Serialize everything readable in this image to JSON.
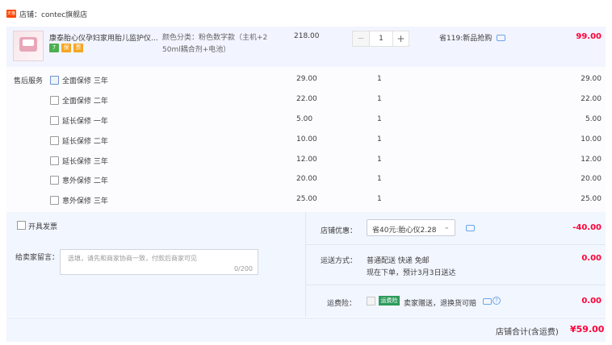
{
  "shop": {
    "badge": "天猫",
    "label": "店铺：contec旗舰店"
  },
  "item": {
    "title": "康泰胎心仪孕妇家用胎儿监护仪...",
    "tags": [
      {
        "text": "7",
        "color": "#4caf50"
      },
      {
        "text": "保",
        "color": "#f5a623"
      },
      {
        "text": "票",
        "color": "#f5a623"
      }
    ],
    "spec_line1": "颜色分类：粉色数字款（主机+2",
    "spec_line2": "50ml耦合剂+电池）",
    "unit_price": "218.00",
    "qty_minus": "−",
    "qty_value": "1",
    "qty_plus": "+",
    "save_text": "省119:新品抢购",
    "total": "99.00"
  },
  "services": {
    "label": "售后服务",
    "rows": [
      {
        "name": "全面保修 三年",
        "price": "29.00",
        "qty": "1",
        "total": "29.00"
      },
      {
        "name": "全面保修 二年",
        "price": "22.00",
        "qty": "1",
        "total": "22.00"
      },
      {
        "name": "延长保修 一年",
        "price": "5.00",
        "qty": "1",
        "total": "5.00"
      },
      {
        "name": "延长保修 二年",
        "price": "10.00",
        "qty": "1",
        "total": "10.00"
      },
      {
        "name": "延长保修 三年",
        "price": "12.00",
        "qty": "1",
        "total": "12.00"
      },
      {
        "name": "意外保修 二年",
        "price": "20.00",
        "qty": "1",
        "total": "20.00"
      },
      {
        "name": "意外保修 三年",
        "price": "25.00",
        "qty": "1",
        "total": "25.00"
      }
    ]
  },
  "invoice": {
    "label": "开具发票"
  },
  "message": {
    "label": "给卖家留言：",
    "placeholder": "选填，请先和商家协商一致，付款后商家可见",
    "count": "0/200"
  },
  "coupon": {
    "label": "店铺优惠：",
    "selected": "省40元:胎心仪2.28",
    "value": "-40.00"
  },
  "shipping": {
    "label": "运送方式：",
    "line1": "普通配送 快递 免邮",
    "line2": "现在下单，预计3月3日送达",
    "value": "0.00"
  },
  "insurance": {
    "label": "运费险：",
    "badge": "运费险",
    "text": "卖家赠送，退换货可赔",
    "help": "?",
    "value": "0.00"
  },
  "summary": {
    "label": "店铺合计(含运费)",
    "amount": "¥59.00"
  },
  "colors": {
    "accent": "#ff0036",
    "brand": "#ff4400"
  }
}
